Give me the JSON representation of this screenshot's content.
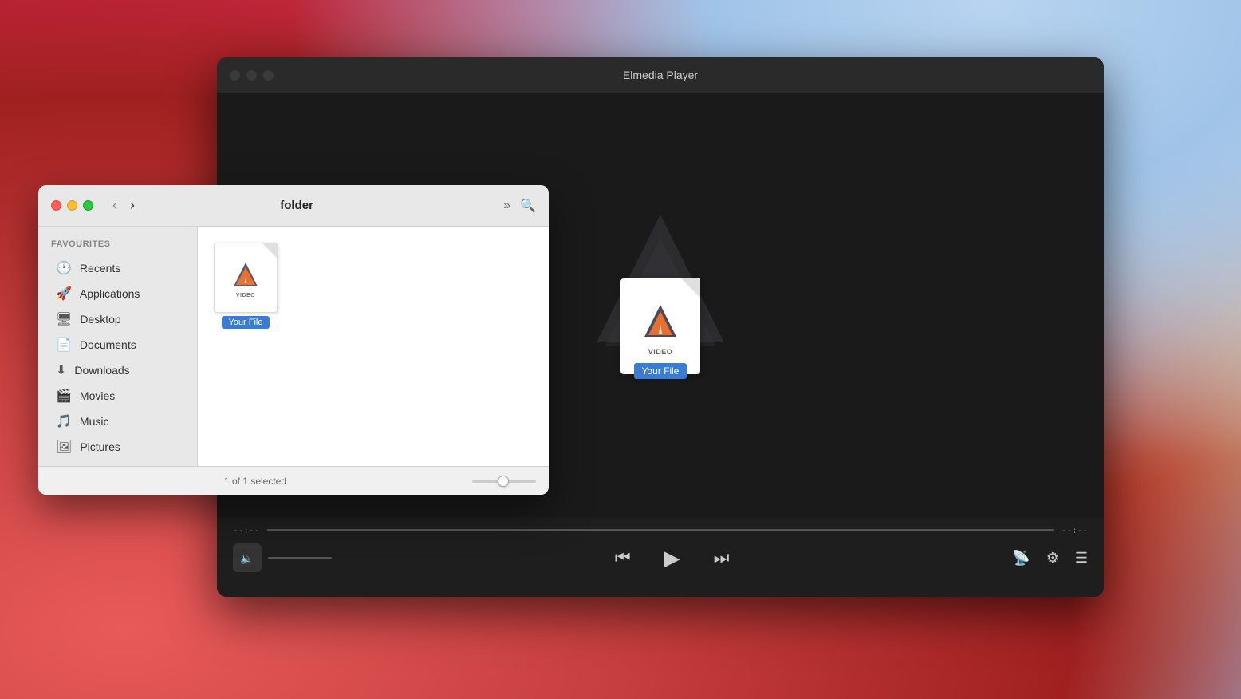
{
  "desktop": {
    "bg": "macOS Monterey gradient"
  },
  "player": {
    "title": "Elmedia Player",
    "traffic": [
      "#ff5f57",
      "#febc2e",
      "#28c840"
    ],
    "file": {
      "name": "Your File",
      "type": "VIDEO"
    },
    "controls": {
      "time_start": "--:--",
      "time_end": "--:--",
      "prev_label": "prev",
      "play_label": "play",
      "next_label": "next",
      "airplay_label": "airplay",
      "settings_label": "settings",
      "playlist_label": "playlist"
    }
  },
  "finder": {
    "title": "folder",
    "traffic": {
      "close": "#ff5f57",
      "minimize": "#febc2e",
      "maximize": "#28c840"
    },
    "sidebar": {
      "section_label": "Favourites",
      "items": [
        {
          "icon": "⏱",
          "label": "Recents"
        },
        {
          "icon": "🚀",
          "label": "Applications"
        },
        {
          "icon": "🖥",
          "label": "Desktop"
        },
        {
          "icon": "📄",
          "label": "Documents"
        },
        {
          "icon": "⬇",
          "label": "Downloads"
        },
        {
          "icon": "🎬",
          "label": "Movies"
        },
        {
          "icon": "🎵",
          "label": "Music"
        },
        {
          "icon": "🖼",
          "label": "Pictures"
        }
      ]
    },
    "file": {
      "name": "Your File",
      "type": "VIDEO"
    },
    "statusbar": {
      "text": "1 of 1 selected"
    }
  }
}
